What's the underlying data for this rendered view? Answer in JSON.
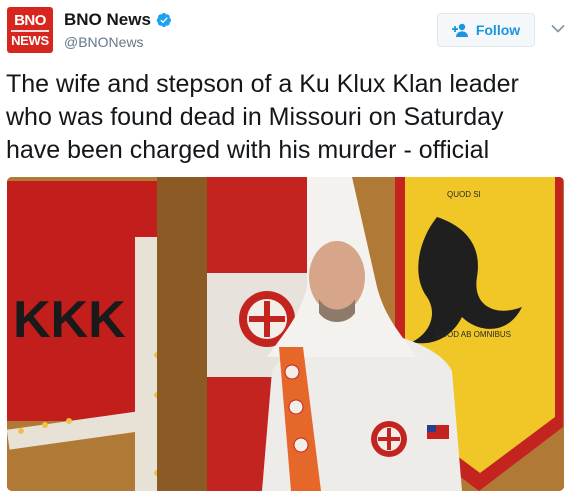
{
  "account": {
    "avatar_line1": "BNO",
    "avatar_line2": "NEWS",
    "name": "BNO News",
    "handle": "@BNONews",
    "verified": true
  },
  "follow_button": {
    "label": "Follow"
  },
  "tweet": {
    "text": "The wife and stepson of a Ku Klux Klan leader who was found dead in Missouri on Saturday have been charged with his murder - official"
  },
  "media": {
    "flag_text": "KKK",
    "banner_text_top": "QUOD SI",
    "banner_text_bottom": "QUOD AB OMNIBUS"
  },
  "colors": {
    "brand_red": "#d7261e",
    "link_blue": "#1b95e0",
    "text": "#14171a",
    "muted": "#657786"
  },
  "icons": {
    "verified": "verified-badge-icon",
    "follow": "add-user-icon",
    "menu": "chevron-down-icon"
  }
}
